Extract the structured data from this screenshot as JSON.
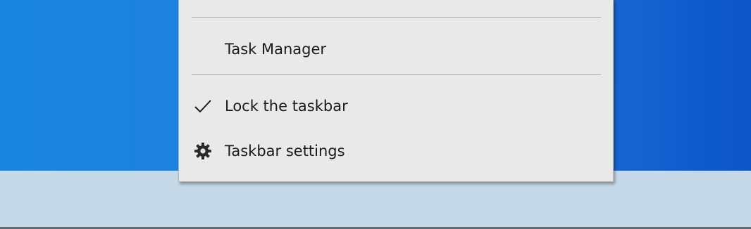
{
  "menu": {
    "items": [
      {
        "label": "Task Manager",
        "icon": ""
      },
      {
        "label": "Lock the taskbar",
        "icon": "checkmark-icon",
        "checked": true
      },
      {
        "label": "Taskbar settings",
        "icon": "gear-icon"
      }
    ]
  },
  "colors": {
    "desktop_left": "#1a86e0",
    "desktop_right": "#0b55c8",
    "taskbar": "#c5d9e8",
    "menu_bg": "#e9e9e9",
    "separator": "#a9a9a9",
    "text": "#1a1a1a"
  }
}
